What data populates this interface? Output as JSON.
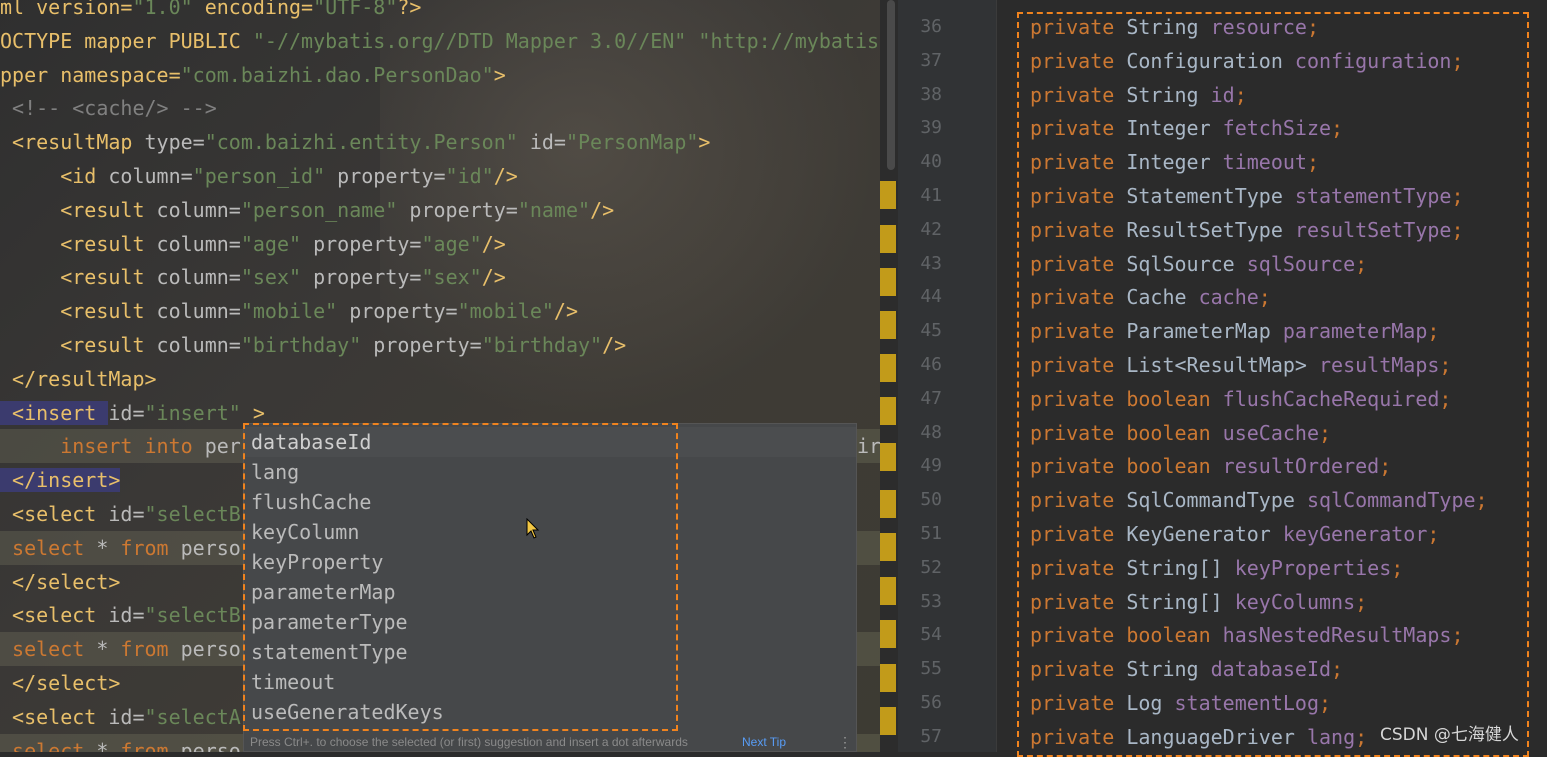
{
  "left_editor": {
    "lines": [
      {
        "parts": [
          [
            "ml version=",
            "tag"
          ],
          [
            "\"1.0\"",
            "str"
          ],
          [
            " encoding=",
            "tag"
          ],
          [
            "\"UTF-8\"",
            "str"
          ],
          [
            "?>",
            "tag"
          ]
        ]
      },
      {
        "parts": [
          [
            "OCTYPE mapper PUBLIC ",
            "tag"
          ],
          [
            "\"-//mybatis.org//DTD Mapper 3.0//EN\"",
            "str"
          ],
          [
            " ",
            "tag"
          ],
          [
            "\"http://mybatis.c",
            "str"
          ]
        ]
      },
      {
        "parts": [
          [
            "pper namespace=",
            "tag"
          ],
          [
            "\"com.baizhi.dao.PersonDao\"",
            "str"
          ],
          [
            ">",
            "tag"
          ]
        ]
      },
      {
        "parts": [
          [
            " <!-- <cache/> -->",
            "cm"
          ]
        ]
      },
      {
        "parts": [
          [
            " <resultMap ",
            "tag"
          ],
          [
            "type=",
            "attr"
          ],
          [
            "\"com.baizhi.entity.Person\"",
            "str"
          ],
          [
            " id=",
            "attr"
          ],
          [
            "\"PersonMap\"",
            "str"
          ],
          [
            ">",
            "tag"
          ]
        ]
      },
      {
        "parts": [
          [
            "     <id ",
            "tag"
          ],
          [
            "column=",
            "attr"
          ],
          [
            "\"person_id\"",
            "str"
          ],
          [
            " property=",
            "attr"
          ],
          [
            "\"id\"",
            "str"
          ],
          [
            "/>",
            "tag"
          ]
        ]
      },
      {
        "parts": [
          [
            "     <result ",
            "tag"
          ],
          [
            "column=",
            "attr"
          ],
          [
            "\"person_name\"",
            "str"
          ],
          [
            " property=",
            "attr"
          ],
          [
            "\"name\"",
            "str"
          ],
          [
            "/>",
            "tag"
          ]
        ]
      },
      {
        "parts": [
          [
            "     <result ",
            "tag"
          ],
          [
            "column=",
            "attr"
          ],
          [
            "\"age\"",
            "str"
          ],
          [
            " property=",
            "attr"
          ],
          [
            "\"age\"",
            "str"
          ],
          [
            "/>",
            "tag"
          ]
        ]
      },
      {
        "parts": [
          [
            "     <result ",
            "tag"
          ],
          [
            "column=",
            "attr"
          ],
          [
            "\"sex\"",
            "str"
          ],
          [
            " property=",
            "attr"
          ],
          [
            "\"sex\"",
            "str"
          ],
          [
            "/>",
            "tag"
          ]
        ]
      },
      {
        "parts": [
          [
            "     <result ",
            "tag"
          ],
          [
            "column=",
            "attr"
          ],
          [
            "\"mobile\"",
            "str"
          ],
          [
            " property=",
            "attr"
          ],
          [
            "\"mobile\"",
            "str"
          ],
          [
            "/>",
            "tag"
          ]
        ]
      },
      {
        "parts": [
          [
            "     <result ",
            "tag"
          ],
          [
            "column=",
            "attr"
          ],
          [
            "\"birthday\"",
            "str"
          ],
          [
            " property=",
            "attr"
          ],
          [
            "\"birthday\"",
            "str"
          ],
          [
            "/>",
            "tag"
          ]
        ]
      },
      {
        "parts": [
          [
            " </resultMap>",
            "tag"
          ]
        ]
      },
      {
        "parts": [
          [
            " <insert ",
            "tag"
          ],
          [
            "id=",
            "attr"
          ],
          [
            "\"insert\"",
            "str"
          ],
          [
            " >",
            "tag"
          ]
        ]
      },
      {
        "parts": [
          [
            "     insert into ",
            "kw"
          ],
          [
            "per",
            "attr"
          ]
        ],
        "tail": "irth"
      },
      {
        "parts": [
          [
            " </insert>",
            "tag"
          ]
        ]
      },
      {
        "parts": [
          [
            " <select ",
            "tag"
          ],
          [
            "id=",
            "attr"
          ],
          [
            "\"selectB",
            "str"
          ]
        ]
      },
      {
        "parts": [
          [
            " select ",
            "kw"
          ],
          [
            "* ",
            "attr"
          ],
          [
            "from ",
            "kw"
          ],
          [
            "perso",
            "attr"
          ]
        ]
      },
      {
        "parts": [
          [
            " </select>",
            "tag"
          ]
        ]
      },
      {
        "parts": [
          [
            " <select ",
            "tag"
          ],
          [
            "id=",
            "attr"
          ],
          [
            "\"selectB",
            "str"
          ]
        ]
      },
      {
        "parts": [
          [
            " select ",
            "kw"
          ],
          [
            "* ",
            "attr"
          ],
          [
            "from ",
            "kw"
          ],
          [
            "perso",
            "attr"
          ]
        ]
      },
      {
        "parts": [
          [
            " </select>",
            "tag"
          ]
        ]
      },
      {
        "parts": [
          [
            " <select ",
            "tag"
          ],
          [
            "id=",
            "attr"
          ],
          [
            "\"selectA",
            "str"
          ]
        ]
      },
      {
        "parts": [
          [
            " select ",
            "kw"
          ],
          [
            "* ",
            "attr"
          ],
          [
            "from ",
            "kw"
          ],
          [
            "perso",
            "attr"
          ]
        ]
      }
    ]
  },
  "completion_popup": {
    "items": [
      "databaseId",
      "lang",
      "flushCache",
      "keyColumn",
      "keyProperty",
      "parameterMap",
      "parameterType",
      "statementType",
      "timeout",
      "useGeneratedKeys"
    ],
    "selected_index": 0,
    "footer_text": "Press Ctrl+. to choose the selected (or first) suggestion and insert a dot afterwards",
    "next_tip_label": "Next Tip",
    "more_glyph": "⋮"
  },
  "right_editor": {
    "line_numbers": [
      "36",
      "37",
      "38",
      "39",
      "40",
      "41",
      "42",
      "43",
      "44",
      "45",
      "46",
      "47",
      "48",
      "49",
      "50",
      "51",
      "52",
      "53",
      "54",
      "55",
      "56",
      "57"
    ],
    "lines": [
      {
        "mod": "private",
        "type": "String",
        "name": "resource"
      },
      {
        "mod": "private",
        "type": "Configuration",
        "name": "configuration"
      },
      {
        "mod": "private",
        "type": "String",
        "name": "id"
      },
      {
        "mod": "private",
        "type": "Integer",
        "name": "fetchSize"
      },
      {
        "mod": "private",
        "type": "Integer",
        "name": "timeout"
      },
      {
        "mod": "private",
        "type": "StatementType",
        "name": "statementType"
      },
      {
        "mod": "private",
        "type": "ResultSetType",
        "name": "resultSetType"
      },
      {
        "mod": "private",
        "type": "SqlSource",
        "name": "sqlSource"
      },
      {
        "mod": "private",
        "type": "Cache",
        "name": "cache"
      },
      {
        "mod": "private",
        "type": "ParameterMap",
        "name": "parameterMap"
      },
      {
        "mod": "private",
        "type": "List<ResultMap>",
        "name": "resultMaps"
      },
      {
        "mod": "private",
        "type": "boolean",
        "name": "flushCacheRequired",
        "kwtype": true
      },
      {
        "mod": "private",
        "type": "boolean",
        "name": "useCache",
        "kwtype": true
      },
      {
        "mod": "private",
        "type": "boolean",
        "name": "resultOrdered",
        "kwtype": true
      },
      {
        "mod": "private",
        "type": "SqlCommandType",
        "name": "sqlCommandType"
      },
      {
        "mod": "private",
        "type": "KeyGenerator",
        "name": "keyGenerator"
      },
      {
        "mod": "private",
        "type": "String[]",
        "name": "keyProperties"
      },
      {
        "mod": "private",
        "type": "String[]",
        "name": "keyColumns"
      },
      {
        "mod": "private",
        "type": "boolean",
        "name": "hasNestedResultMaps",
        "kwtype": true
      },
      {
        "mod": "private",
        "type": "String",
        "name": "databaseId"
      },
      {
        "mod": "private",
        "type": "Log",
        "name": "statementLog"
      },
      {
        "mod": "private",
        "type": "LanguageDriver",
        "name": "lang"
      }
    ]
  },
  "watermark": "CSDN @七海健人",
  "colors": {
    "accent_box": "#f0831e",
    "marker": "#c29b1a",
    "keyword": "#cc7832",
    "field": "#9876aa",
    "string": "#6a8759",
    "tag": "#e8bf6a"
  }
}
